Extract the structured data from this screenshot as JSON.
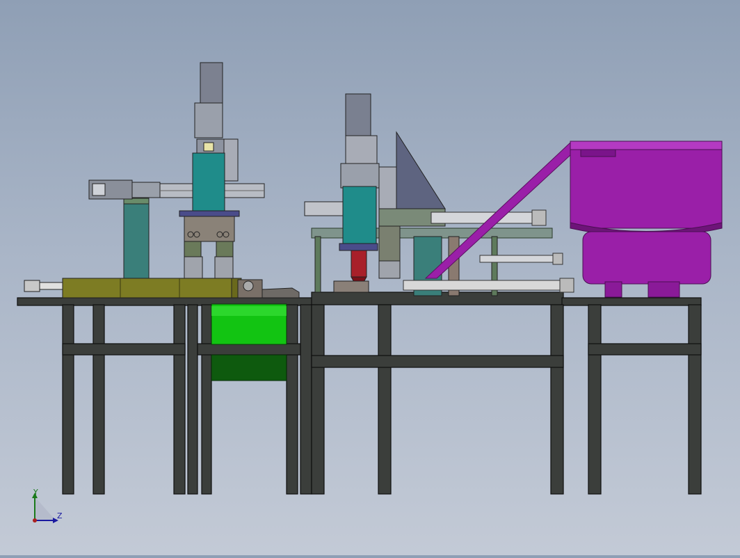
{
  "viewport": {
    "background_top": "#8f9fb5",
    "background_bottom": "#c3cad6"
  },
  "triad": {
    "y_label": "Y",
    "z_label": "Z",
    "y_color": "#1a7a1a",
    "z_color": "#1a1aa0"
  },
  "colors": {
    "frame": "#3a3d3a",
    "frame_edge": "#111111",
    "hopper": "#9a1fa8",
    "hopper_dark": "#6e1479",
    "conveyor_green": "#10c010",
    "motor_teal": "#1f8c8a",
    "olive_plate": "#7a7a22",
    "cylinder_rod": "#d8d8d8",
    "slate": "#5e6480",
    "panel_green": "#5e7a5c",
    "red_nozzle": "#a8202a"
  }
}
